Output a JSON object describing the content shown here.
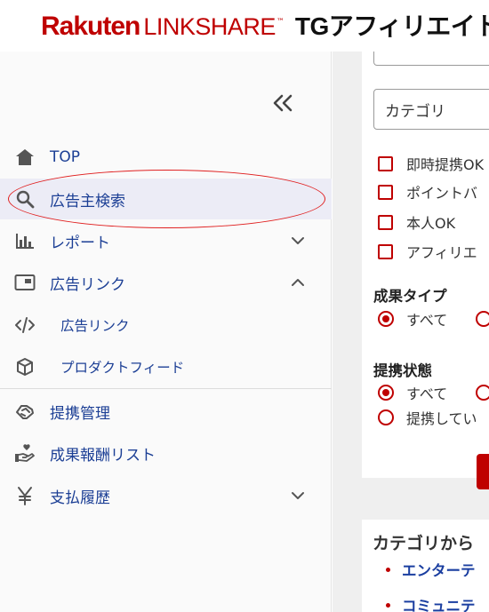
{
  "header": {
    "logo_rakuten": "Rakuten",
    "logo_linkshare": "LINKSHARE",
    "logo_tm": "™",
    "logo_tg": "TGアフィリエイト"
  },
  "sidebar": {
    "items": [
      {
        "label": "TOP",
        "icon": "home-icon"
      },
      {
        "label": "広告主検索",
        "icon": "search-icon",
        "active": true
      },
      {
        "label": "レポート",
        "icon": "bar-chart-icon",
        "chevron": "down"
      },
      {
        "label": "広告リンク",
        "icon": "ad-frame-icon",
        "chevron": "up"
      },
      {
        "label": "広告リンク",
        "icon": "code-icon",
        "sub": true
      },
      {
        "label": "プロダクトフィード",
        "icon": "cube-icon",
        "sub": true
      },
      {
        "label": "提携管理",
        "icon": "handshake-icon"
      },
      {
        "label": "成果報酬リスト",
        "icon": "hand-heart-icon"
      },
      {
        "label": "支払履歴",
        "icon": "yen-icon",
        "chevron": "down"
      }
    ]
  },
  "filters": {
    "category_placeholder": "カテゴリ",
    "checkboxes": [
      "即時提携OK",
      "ポイントバ",
      "本人OK",
      "アフィリエ"
    ],
    "result_type_title": "成果タイプ",
    "result_type_options": [
      "すべて"
    ],
    "partnership_title": "提携状態",
    "partnership_options": [
      "すべて",
      "提携してい"
    ]
  },
  "category_section": {
    "title": "カテゴリから",
    "links": [
      "エンターテ",
      "コミュニテ"
    ]
  },
  "colors": {
    "brand_red": "#bf0000",
    "link_blue": "#1c3f95",
    "annotation_red": "#e02020"
  }
}
